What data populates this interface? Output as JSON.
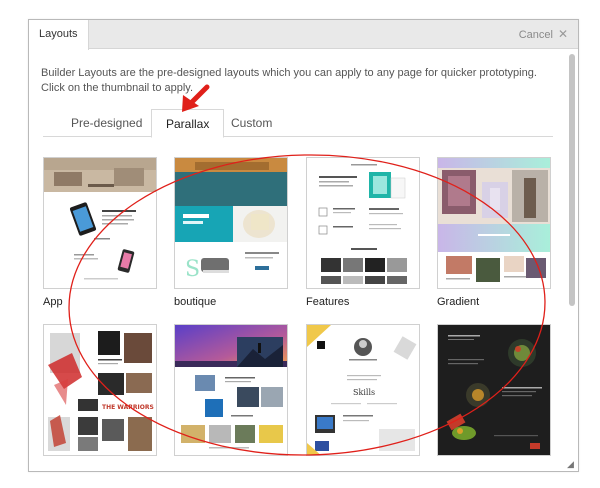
{
  "dialog": {
    "title": "Layouts",
    "cancel_label": "Cancel",
    "description": "Builder Layouts are the pre-designed layouts which you can apply to any page for quicker prototyping. Click on the thumbnail to apply."
  },
  "tabs": [
    {
      "label": "Pre-designed",
      "active": false
    },
    {
      "label": "Parallax",
      "active": true
    },
    {
      "label": "Custom",
      "active": false
    }
  ],
  "layouts": [
    {
      "label": "App"
    },
    {
      "label": "boutique"
    },
    {
      "label": "Features"
    },
    {
      "label": "Gradient"
    },
    {
      "label": ""
    },
    {
      "label": ""
    },
    {
      "label": ""
    },
    {
      "label": ""
    }
  ],
  "colors": {
    "annotation": "#e0201a",
    "accent_teal": "#1fb5a8",
    "mint": "#a8f0da"
  },
  "icons": {
    "close": "close-icon",
    "arrow": "arrow-annotation",
    "resize": "resize-grip-icon"
  }
}
